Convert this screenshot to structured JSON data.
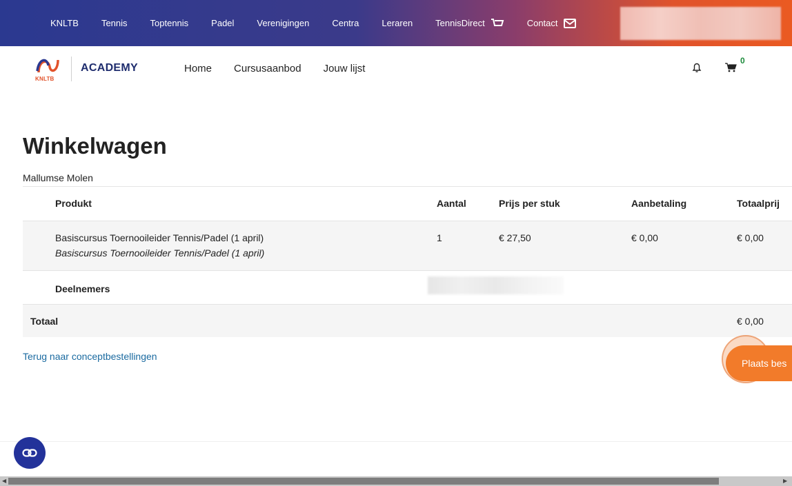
{
  "topbar": {
    "links": [
      "KNLTB",
      "Tennis",
      "Toptennis",
      "Padel",
      "Verenigingen",
      "Centra",
      "Leraren",
      "TennisDirect",
      "Contact"
    ],
    "colors": {
      "gradient_start": "#2b3990",
      "gradient_end": "#ea5a22"
    }
  },
  "subnav": {
    "logo_text": "KNLTB",
    "academy": "ACADEMY",
    "links": [
      "Home",
      "Cursusaanbod",
      "Jouw lijst"
    ],
    "cart_count": "0"
  },
  "page": {
    "title": "Winkelwagen",
    "organization": "Mallumse Molen"
  },
  "table": {
    "headers": {
      "product": "Produkt",
      "quantity": "Aantal",
      "unit_price": "Prijs per stuk",
      "deposit": "Aanbetaling",
      "total_price": "Totaalprij"
    },
    "item": {
      "name": "Basiscursus Toernooileider Tennis/Padel (1 april)",
      "subtitle": "Basiscursus Toernooileider Tennis/Padel (1 april)",
      "quantity": "1",
      "unit_price": "€ 27,50",
      "deposit": "€ 0,00",
      "total": "€ 0,00"
    },
    "participants_label": "Deelnemers",
    "total_label": "Totaal",
    "total_value": "€ 0,00"
  },
  "actions": {
    "back_link": "Terug naar conceptbestellingen",
    "place_order": "Plaats bes"
  },
  "accent_color": "#f27b2a"
}
